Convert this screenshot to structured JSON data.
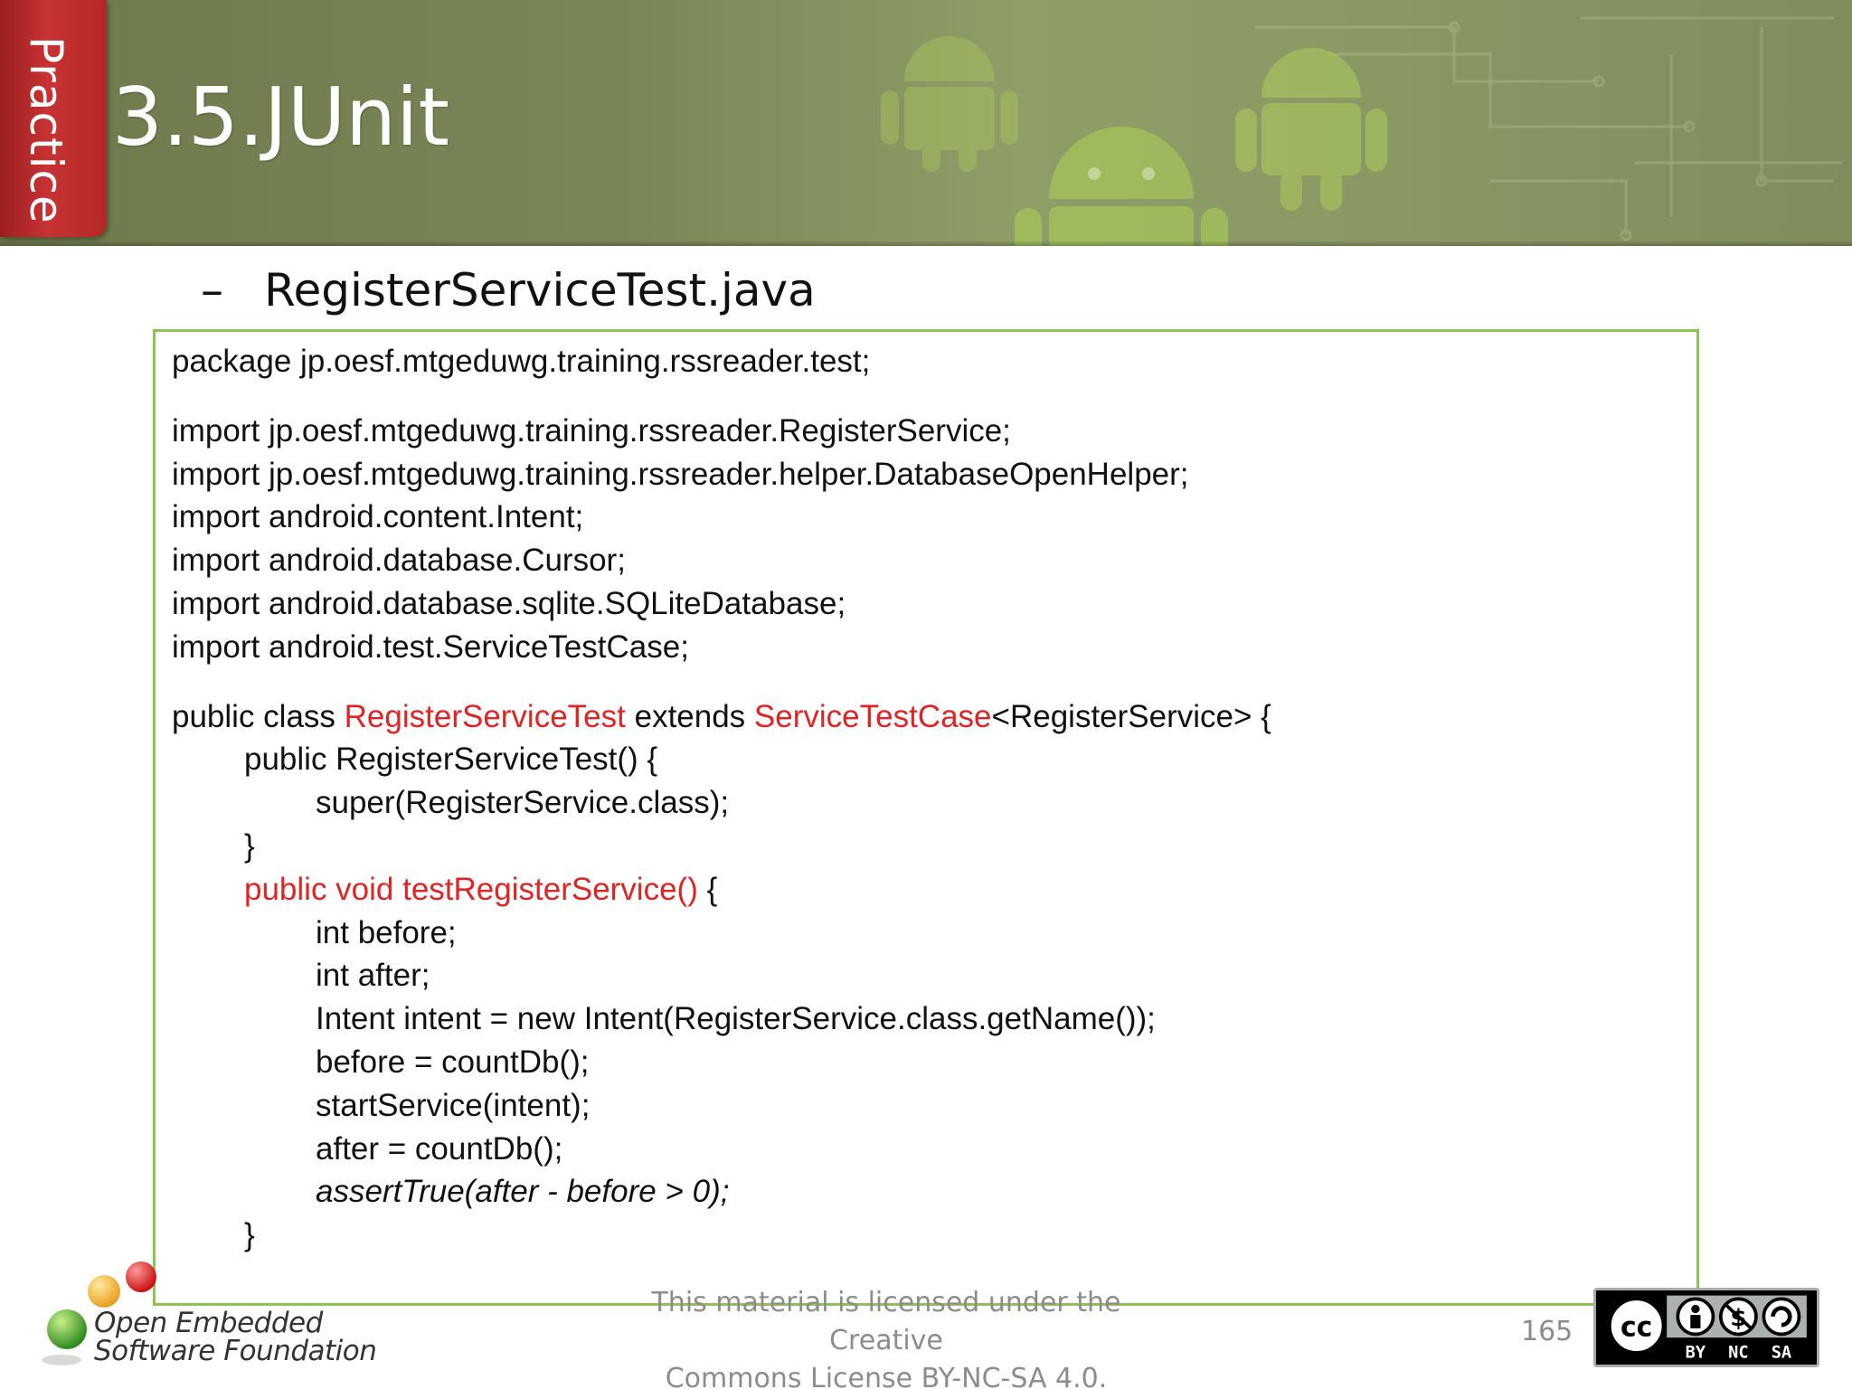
{
  "header": {
    "side_tab": "Practice",
    "title": "3.5.JUnit"
  },
  "file_heading": {
    "dash": "–",
    "name": "RegisterServiceTest.java"
  },
  "code": {
    "l1": "package jp.oesf.mtgeduwg.training.rssreader.test;",
    "l2": "import jp.oesf.mtgeduwg.training.rssreader.RegisterService;",
    "l3": "import jp.oesf.mtgeduwg.training.rssreader.helper.DatabaseOpenHelper;",
    "l4": "import android.content.Intent;",
    "l5": "import android.database.Cursor;",
    "l6": "import android.database.sqlite.SQLiteDatabase;",
    "l7": "import android.test.ServiceTestCase;",
    "l8": {
      "a": "public class ",
      "b": "RegisterServiceTest",
      "c": " extends ",
      "d": "ServiceTestCase",
      "e": "<RegisterService> {"
    },
    "l9": "public RegisterServiceTest() {",
    "l10": "super(RegisterService.class);",
    "l11": "}",
    "l12": {
      "a": "public void testRegisterService()",
      "b": " {"
    },
    "l13": "int before;",
    "l14": "int after;",
    "l15": "Intent intent = new Intent(RegisterService.class.getName());",
    "l16": "before = countDb();",
    "l17": "startService(intent);",
    "l18": "after = countDb();",
    "l19": "assertTrue(after - before > 0);",
    "l20": "}"
  },
  "footer": {
    "logo_line1": "Open Embedded",
    "logo_line2": "Software Foundation",
    "license_line1": "This material is licensed under the Creative",
    "license_line2": "Commons License BY-NC-SA 4.0.",
    "page_number": "165",
    "cc_labels": [
      "BY",
      "NC",
      "SA"
    ]
  },
  "colors": {
    "banner_green": "#7b8758",
    "tab_red": "#c83232",
    "code_highlight_red": "#e02323",
    "code_box_border": "#8dc255"
  }
}
